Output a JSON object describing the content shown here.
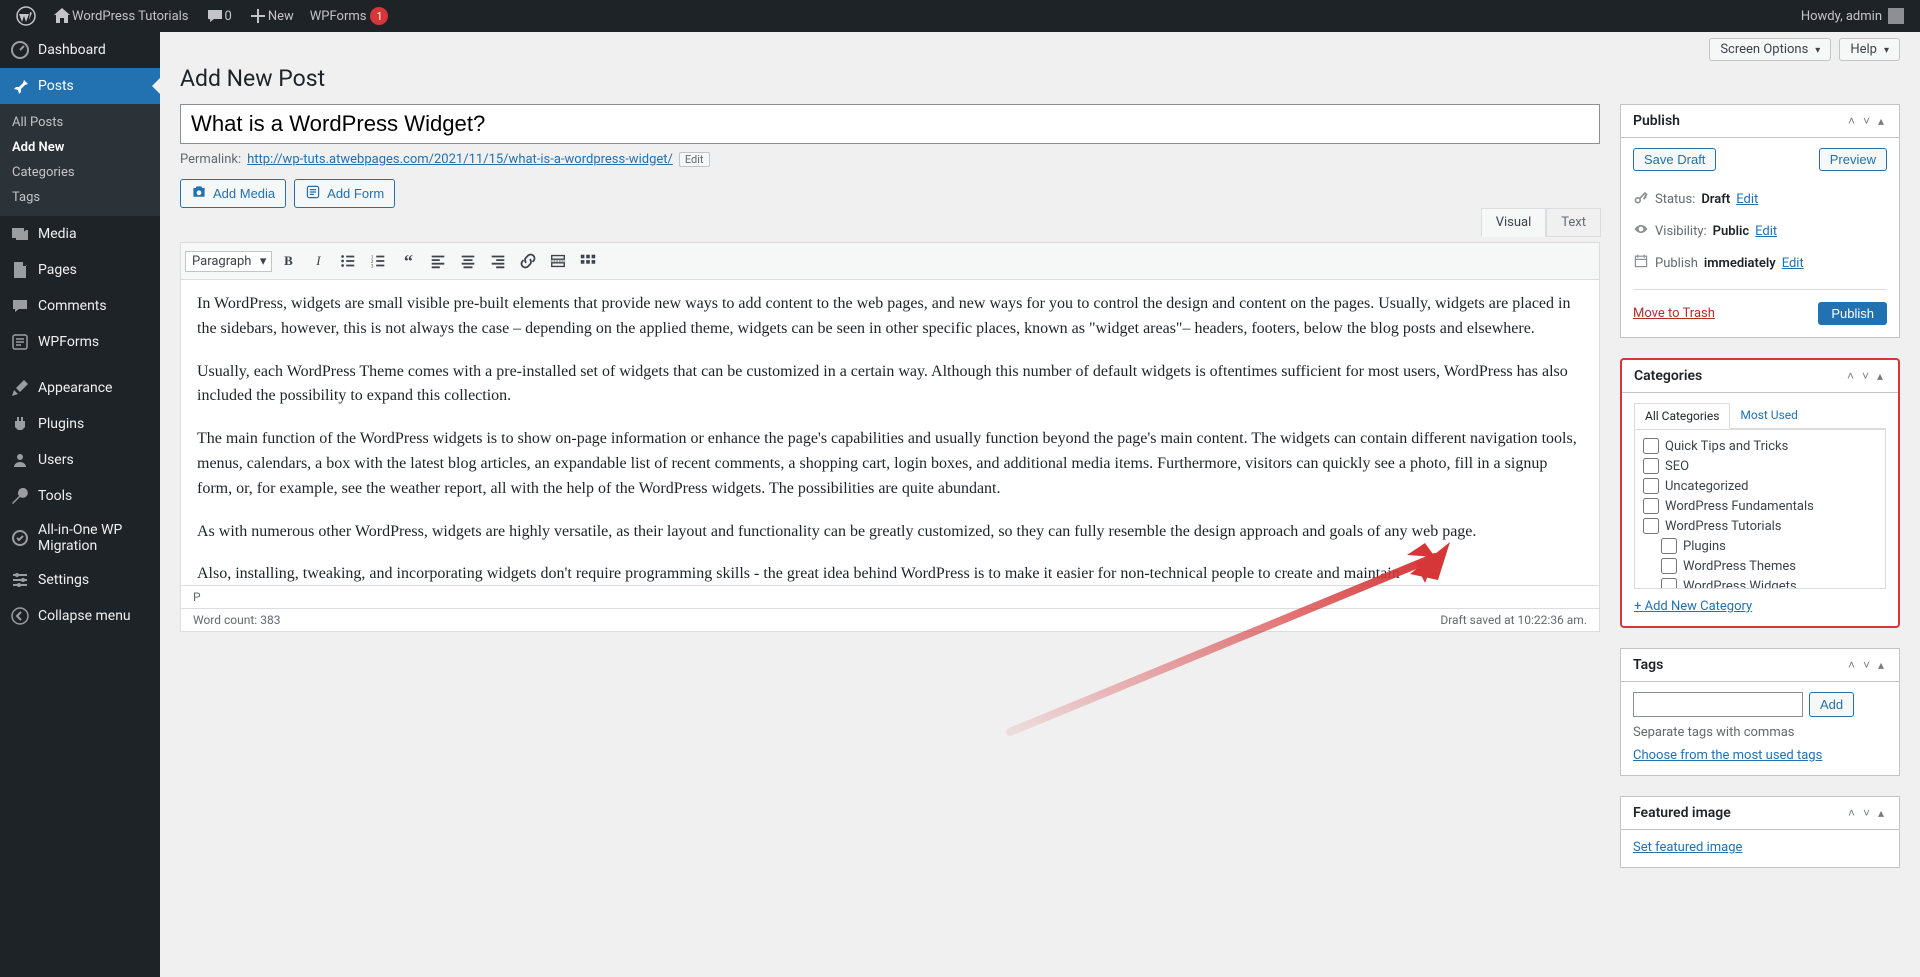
{
  "adminbar": {
    "site_name": "WordPress Tutorials",
    "comments_count": "0",
    "new_label": "New",
    "wpforms_label": "WPForms",
    "wpforms_badge": "1",
    "howdy": "Howdy, admin"
  },
  "sidebar": {
    "items": [
      {
        "label": "Dashboard"
      },
      {
        "label": "Posts"
      },
      {
        "label": "Media"
      },
      {
        "label": "Pages"
      },
      {
        "label": "Comments"
      },
      {
        "label": "WPForms"
      },
      {
        "label": "Appearance"
      },
      {
        "label": "Plugins"
      },
      {
        "label": "Users"
      },
      {
        "label": "Tools"
      },
      {
        "label": "All-in-One WP Migration"
      },
      {
        "label": "Settings"
      },
      {
        "label": "Collapse menu"
      }
    ],
    "posts_submenu": [
      "All Posts",
      "Add New",
      "Categories",
      "Tags"
    ]
  },
  "screen": {
    "options": "Screen Options",
    "help": "Help"
  },
  "page": {
    "heading": "Add New Post",
    "title": "What is a WordPress Widget?",
    "permalink_label": "Permalink:",
    "permalink_base": "http://wp-tuts.atwebpages.com/2021/11/15/",
    "permalink_slug": "what-is-a-wordpress-widget/",
    "edit": "Edit",
    "add_media": "Add Media",
    "add_form": "Add Form",
    "tab_visual": "Visual",
    "tab_text": "Text",
    "format_select": "Paragraph",
    "content": {
      "p1": "In WordPress, widgets are small visible pre-built elements that provide new ways to add content to the web pages, and new ways for you to control the design and content on the pages. Usually, widgets are placed in the sidebars, however, this is not always the case – depending on the applied theme, widgets can be seen in other specific places, known as \"widget areas\"– headers, footers, below the blog posts and elsewhere.",
      "p2": "Usually, each WordPress Theme comes with a pre-installed set of widgets that can be customized in a certain way. Although this number of default widgets is oftentimes sufficient for most users, WordPress has also included the possibility to expand this collection.",
      "p3": "The main function of the WordPress widgets is to show on-page information or enhance the page's capabilities and usually function beyond the page's main content. The widgets can contain different navigation tools, menus, calendars, a box with the latest blog articles, an expandable list of recent comments, a shopping cart, login boxes, and additional media items. Furthermore, visitors can quickly see a photo, fill in a signup form, or, for example, see the weather report, all with the help of the WordPress widgets. The possibilities are quite abundant.",
      "p4": "As with numerous other WordPress, widgets are highly versatile, as their layout and functionality can be greatly customized, so they can fully resemble the design approach and goals of any web page.",
      "p5": "Also, installing, tweaking, and incorporating widgets don't require programming skills - the great idea behind WordPress is to make it easier for non-technical people to create and maintain"
    },
    "path_status": "P",
    "word_count_label": "Word count:",
    "word_count": "383",
    "draft_saved": "Draft saved at 10:22:36 am."
  },
  "publish": {
    "title": "Publish",
    "save_draft": "Save Draft",
    "preview": "Preview",
    "status_label": "Status:",
    "status_value": "Draft",
    "vis_label": "Visibility:",
    "vis_value": "Public",
    "pub_label": "Publish",
    "pub_value": "immediately",
    "edit": "Edit",
    "trash": "Move to Trash",
    "publish_btn": "Publish"
  },
  "categories": {
    "title": "Categories",
    "tab_all": "All Categories",
    "tab_most": "Most Used",
    "items": [
      {
        "label": "Quick Tips and Tricks"
      },
      {
        "label": "SEO"
      },
      {
        "label": "Uncategorized"
      },
      {
        "label": "WordPress Fundamentals"
      },
      {
        "label": "WordPress Tutorials"
      }
    ],
    "children": [
      {
        "label": "Plugins"
      },
      {
        "label": "WordPress Themes"
      },
      {
        "label": "WordPress Widgets"
      }
    ],
    "add_new": "+ Add New Category"
  },
  "tags": {
    "title": "Tags",
    "add": "Add",
    "howto": "Separate tags with commas",
    "choose": "Choose from the most used tags"
  },
  "featured": {
    "title": "Featured image",
    "set": "Set featured image"
  }
}
